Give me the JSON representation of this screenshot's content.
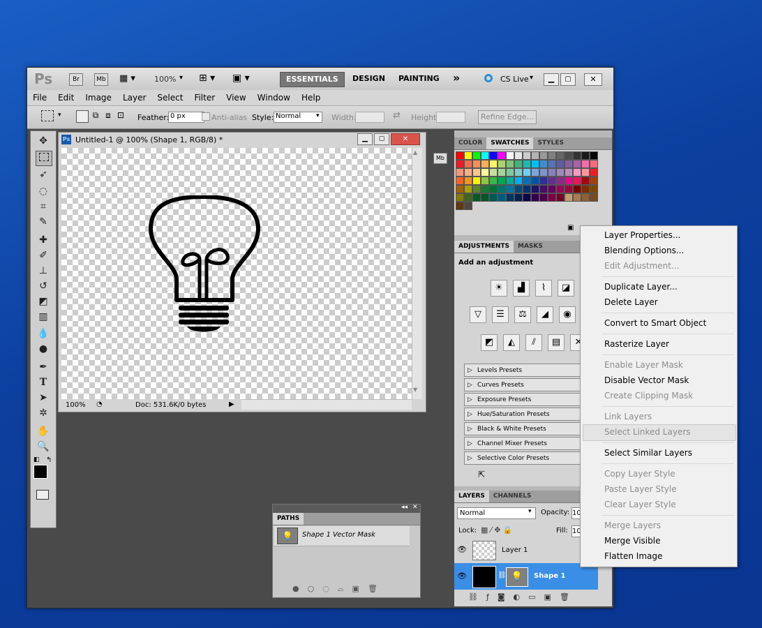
{
  "app": {
    "logo": "Ps",
    "bridge": "Br",
    "mini_bridge": "Mb",
    "zoom": "100%",
    "workspaces": [
      "ESSENTIALS",
      "DESIGN",
      "PAINTING"
    ],
    "more": "»",
    "cslive": "CS Live"
  },
  "menu": [
    "File",
    "Edit",
    "Image",
    "Layer",
    "Select",
    "Filter",
    "View",
    "Window",
    "Help"
  ],
  "options": {
    "feather_label": "Feather:",
    "feather_value": "0 px",
    "antialias": "Anti-alias",
    "style_label": "Style:",
    "style_value": "Normal",
    "width_label": "Width:",
    "height_label": "Height:",
    "refine": "Refine Edge..."
  },
  "document": {
    "badge": "Ps",
    "title": "Untitled-1 @ 100% (Shape 1, RGB/8) *",
    "zoom": "100%",
    "doc_info": "Doc: 531.6K/0 bytes"
  },
  "swatch_panel": {
    "tabs": [
      "COLOR",
      "SWATCHES",
      "STYLES"
    ],
    "colors": [
      "#ff0000",
      "#ffff00",
      "#00ff00",
      "#00ffff",
      "#0000ff",
      "#ff00ff",
      "#ffffff",
      "#e6e6e6",
      "#cccccc",
      "#b3b3b3",
      "#999999",
      "#808080",
      "#666666",
      "#4d4d4d",
      "#333333",
      "#1a1a1a",
      "#000000",
      "#ed1c24",
      "#f26c4f",
      "#f68e55",
      "#fbaf5c",
      "#fff467",
      "#acd372",
      "#7cc576",
      "#3bb878",
      "#1abbb4",
      "#00bff3",
      "#438ccb",
      "#5574b9",
      "#605ca8",
      "#855fa8",
      "#a763a8",
      "#f06ea9",
      "#f26d7d",
      "#f7977a",
      "#f9ad81",
      "#fdc68c",
      "#fff799",
      "#c6df9c",
      "#a4d49d",
      "#81ca9d",
      "#7bcdc9",
      "#6ccff7",
      "#7ca6d8",
      "#8293ca",
      "#8881be",
      "#a286bd",
      "#bc8cbf",
      "#f49bc1",
      "#f5989d",
      "#ed1c24",
      "#f26522",
      "#f7941d",
      "#fff200",
      "#8dc63f",
      "#39b54a",
      "#00a651",
      "#00a99d",
      "#00aeef",
      "#0072bc",
      "#0054a6",
      "#2e3192",
      "#662d91",
      "#92278f",
      "#ec008c",
      "#ed145b",
      "#9e0b0f",
      "#a0410d",
      "#a36209",
      "#aba000",
      "#598527",
      "#197b30",
      "#007236",
      "#00746b",
      "#0076a3",
      "#004b80",
      "#003471",
      "#1b1464",
      "#440e62",
      "#630460",
      "#9e005d",
      "#9e0039",
      "#790000",
      "#7b2e00",
      "#7d4900",
      "#827b00",
      "#406618",
      "#005e20",
      "#005826",
      "#005952",
      "#005b7f",
      "#003663",
      "#002157",
      "#0d004c",
      "#32004b",
      "#4b0049",
      "#7b0046",
      "#7a0026",
      "#c69c6d",
      "#a67c52",
      "#8c6239",
      "#754c24",
      "#603913",
      "#534741"
    ]
  },
  "adjustments": {
    "tabs": [
      "ADJUSTMENTS",
      "MASKS"
    ],
    "heading": "Add an adjustment",
    "presets": [
      "Levels Presets",
      "Curves Presets",
      "Exposure Presets",
      "Hue/Saturation Presets",
      "Black & White Presets",
      "Channel Mixer Presets",
      "Selective Color Presets"
    ]
  },
  "layers": {
    "tabs": [
      "LAYERS",
      "CHANNELS"
    ],
    "blend": "Normal",
    "opacity_label": "Opacity:",
    "opacity_value": "10",
    "lock_label": "Lock:",
    "fill_label": "Fill:",
    "fill_value": "10",
    "items": [
      {
        "name": "Layer 1",
        "selected": false
      },
      {
        "name": "Shape 1",
        "selected": true
      }
    ]
  },
  "paths_panel": {
    "tab": "PATHS",
    "item": "Shape 1 Vector Mask"
  },
  "context_menu": {
    "items": [
      {
        "label": "Layer Properties...",
        "disabled": false
      },
      {
        "label": "Blending Options...",
        "disabled": false
      },
      {
        "label": "Edit Adjustment...",
        "disabled": true
      },
      {
        "label": "Duplicate Layer...",
        "disabled": false
      },
      {
        "label": "Delete Layer",
        "disabled": false
      },
      {
        "label": "Convert to Smart Object",
        "disabled": false
      },
      {
        "label": "Rasterize Layer",
        "disabled": false
      },
      {
        "label": "Enable Layer Mask",
        "disabled": true
      },
      {
        "label": "Disable Vector Mask",
        "disabled": false
      },
      {
        "label": "Create Clipping Mask",
        "disabled": true
      },
      {
        "label": "Link Layers",
        "disabled": true
      },
      {
        "label": "Select Linked Layers",
        "disabled": true
      },
      {
        "label": "Select Similar Layers",
        "disabled": false
      },
      {
        "label": "Copy Layer Style",
        "disabled": true
      },
      {
        "label": "Paste Layer Style",
        "disabled": true
      },
      {
        "label": "Clear Layer Style",
        "disabled": true
      },
      {
        "label": "Merge Layers",
        "disabled": true
      },
      {
        "label": "Merge Visible",
        "disabled": false
      },
      {
        "label": "Flatten Image",
        "disabled": false
      }
    ]
  }
}
